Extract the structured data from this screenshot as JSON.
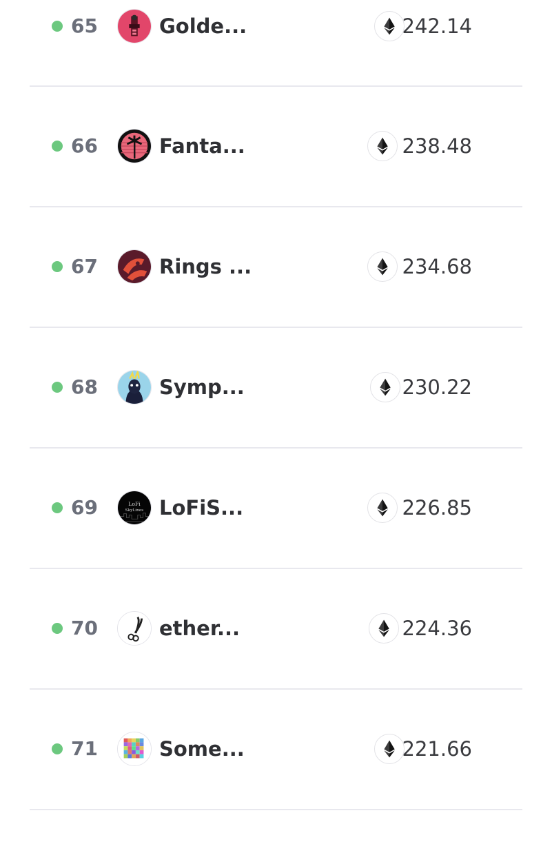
{
  "rows": [
    {
      "rank": "65",
      "name": "Golde...",
      "avatar_icon": "golden-collection-avatar",
      "volume": "242.14",
      "currency_icon": "ethereum-icon",
      "status_color": "#6cc87f"
    },
    {
      "rank": "66",
      "name": "Fanta...",
      "avatar_icon": "palm-tree-avatar",
      "volume": "238.48",
      "currency_icon": "ethereum-icon",
      "status_color": "#6cc87f"
    },
    {
      "rank": "67",
      "name": "Rings ...",
      "avatar_icon": "rings-avatar",
      "volume": "234.68",
      "currency_icon": "ethereum-icon",
      "status_color": "#6cc87f"
    },
    {
      "rank": "68",
      "name": "Symp...",
      "avatar_icon": "character-avatar",
      "volume": "230.22",
      "currency_icon": "ethereum-icon",
      "status_color": "#6cc87f"
    },
    {
      "rank": "69",
      "name": "LoFiS...",
      "avatar_icon": "lofi-skyline-avatar",
      "avatar_text": [
        "LoFi",
        "SkyLines"
      ],
      "volume": "226.85",
      "currency_icon": "ethereum-icon",
      "status_color": "#6cc87f"
    },
    {
      "rank": "70",
      "name": "ether...",
      "avatar_icon": "scissors-avatar",
      "volume": "224.36",
      "currency_icon": "ethereum-icon",
      "status_color": "#6cc87f"
    },
    {
      "rank": "71",
      "name": "Some...",
      "avatar_icon": "color-grid-avatar",
      "volume": "221.66",
      "currency_icon": "ethereum-icon",
      "status_color": "#6cc87f"
    }
  ]
}
